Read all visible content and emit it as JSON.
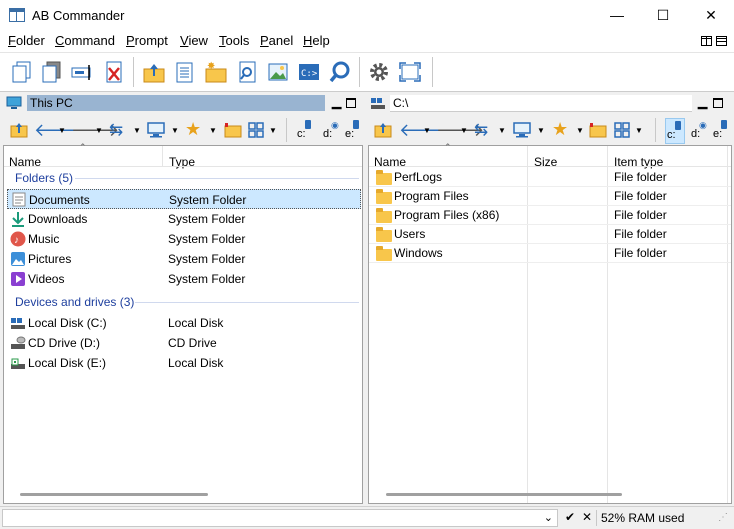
{
  "window": {
    "title": "AB Commander",
    "minimize": "—",
    "maximize": "☐",
    "close": "✕"
  },
  "menu": [
    "Folder",
    "Command",
    "Prompt",
    "View",
    "Tools",
    "Panel",
    "Help"
  ],
  "left_panel": {
    "path": "This PC",
    "columns": [
      "Name",
      "Type"
    ],
    "groups": [
      {
        "label": "Folders (5)",
        "items": [
          {
            "name": "Documents",
            "type": "System Folder",
            "icon": "documents-icon"
          },
          {
            "name": "Downloads",
            "type": "System Folder",
            "icon": "downloads-icon"
          },
          {
            "name": "Music",
            "type": "System Folder",
            "icon": "music-icon"
          },
          {
            "name": "Pictures",
            "type": "System Folder",
            "icon": "pictures-icon"
          },
          {
            "name": "Videos",
            "type": "System Folder",
            "icon": "videos-icon"
          }
        ]
      },
      {
        "label": "Devices and drives (3)",
        "items": [
          {
            "name": "Local Disk (C:)",
            "type": "Local Disk",
            "icon": "hard-drive-icon"
          },
          {
            "name": "CD Drive (D:)",
            "type": "CD Drive",
            "icon": "cd-drive-icon"
          },
          {
            "name": "Local Disk (E:)",
            "type": "Local Disk",
            "icon": "usb-drive-icon"
          }
        ]
      }
    ],
    "drives": [
      "c:",
      "d:",
      "e:"
    ]
  },
  "right_panel": {
    "path": "C:\\",
    "columns": [
      "Name",
      "Size",
      "Item type"
    ],
    "items": [
      {
        "name": "PerfLogs",
        "size": "",
        "type": "File folder"
      },
      {
        "name": "Program Files",
        "size": "",
        "type": "File folder"
      },
      {
        "name": "Program Files (x86)",
        "size": "",
        "type": "File folder"
      },
      {
        "name": "Users",
        "size": "",
        "type": "File folder"
      },
      {
        "name": "Windows",
        "size": "",
        "type": "File folder"
      }
    ],
    "drives": [
      "c:",
      "d:",
      "e:"
    ]
  },
  "status": {
    "ram": "52% RAM used",
    "ok": "✔",
    "cancel": "✕"
  },
  "colors": {
    "selection": "#cce8ff",
    "path_highlight": "#99b4d1",
    "group_text": "#1e3f9e",
    "folder": "#f8c64b"
  }
}
